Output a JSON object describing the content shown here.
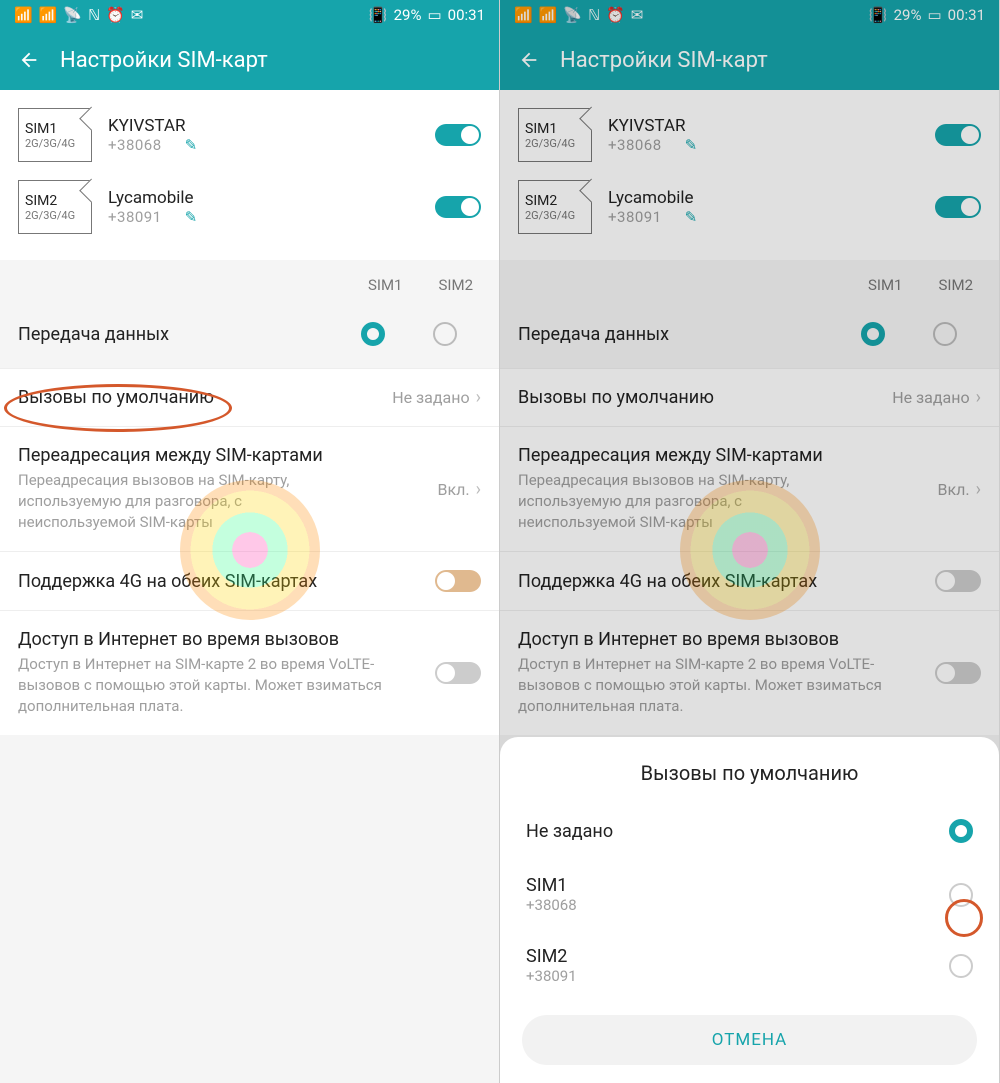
{
  "status": {
    "battery": "29%",
    "time": "00:31"
  },
  "header": {
    "title": "Настройки SIM-карт"
  },
  "sims": [
    {
      "slot": "SIM1",
      "net": "2G/3G/4G",
      "op": "KYIVSTAR",
      "num": "+38068"
    },
    {
      "slot": "SIM2",
      "net": "2G/3G/4G",
      "op": "Lycamobile",
      "num": "+38091"
    }
  ],
  "labels": {
    "sim1": "SIM1",
    "sim2": "SIM2",
    "data": "Передача данных",
    "default_calls": "Вызовы по умолчанию",
    "not_set": "Не задано",
    "forward_title": "Переадресация между SIM-картами",
    "forward_sub": "Переадресация вызовов на SIM-карту, используемую для разговора, с неиспользуемой SIM-карты",
    "forward_val": "Вкл.",
    "dual4g": "Поддержка 4G на обеих SIM-картах",
    "inet_title": "Доступ в Интернет во время вызовов",
    "inet_sub": "Доступ в Интернет на SIM-карте 2 во время VoLTE-вызовов с помощью этой карты. Может взиматься дополнительная плата."
  },
  "dialog": {
    "title": "Вызовы по умолчанию",
    "opt_notset": "Не задано",
    "opt1_name": "SIM1",
    "opt1_num": "+38068",
    "opt2_name": "SIM2",
    "opt2_num": "+38091",
    "cancel": "ОТМЕНА"
  }
}
